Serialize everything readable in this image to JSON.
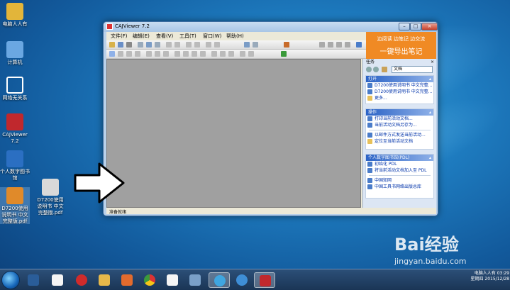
{
  "desktop": {
    "icons": [
      {
        "label": "电脑人人有",
        "color": "#e2b53a"
      },
      {
        "label": "计算机",
        "color": "#6aa7e2"
      },
      {
        "label": "网络无关系",
        "color": "#ffffff"
      },
      {
        "label": "CAJViewer 7.2",
        "color": "#c0282d"
      },
      {
        "label": "个人数字图书馆",
        "color": "#2b6fc2"
      },
      {
        "label": "D7200使用说明书 中文完整版.pdf",
        "color": "#e08a2a"
      },
      {
        "label": "D7200使用说明书 中文完整版.pdf",
        "color": "#d9d9d9"
      }
    ]
  },
  "window": {
    "title": "CAJViewer 7.2",
    "controls": {
      "minimize": "–",
      "maximize": "□",
      "close": "×"
    },
    "menu": [
      "文件(F)",
      "编辑(E)",
      "查看(V)",
      "工具(T)",
      "窗口(W)",
      "帮助(H)"
    ],
    "promo": {
      "line1": "边阅读 边笔记 边交流",
      "line2": "一键导出笔记"
    },
    "status": "准备就绪"
  },
  "task_pane": {
    "title": "任务",
    "close": "×",
    "selector": "文档",
    "sections": [
      {
        "title": "打开",
        "items": [
          {
            "text": "D7200使用说明书 中文完整...",
            "icon": "document-icon"
          },
          {
            "text": "D7200使用说明书 中文完整...",
            "icon": "document-icon"
          },
          {
            "text": "更多...",
            "icon": "folder-icon"
          }
        ]
      },
      {
        "title": "操作",
        "items": [
          {
            "text": "打印当前活动文档...",
            "icon": "print-icon"
          },
          {
            "text": "当前活动文档另存为...",
            "icon": "save-icon"
          },
          {
            "text": "以邮件方式发送当前活动...",
            "icon": "email-icon"
          },
          {
            "text": "定位至当前活动文档",
            "icon": "locate-icon"
          }
        ]
      },
      {
        "title": "个人数字图书馆(PDL)",
        "items": [
          {
            "text": "初始化 PDL",
            "icon": "init-icon"
          },
          {
            "text": "将当前活动文档加入至 PDL",
            "icon": "add-icon"
          },
          {
            "text": "中国知网",
            "icon": "web-icon"
          },
          {
            "text": "中国工具书网络出版总库",
            "icon": "web-icon"
          }
        ]
      }
    ]
  },
  "taskbar": {
    "apps": [
      {
        "name": "desktop-app",
        "color": "#2a5d99"
      },
      {
        "name": "explorer-app",
        "color": "#f5f5f5"
      },
      {
        "name": "chinese-app",
        "color": "#d02b2b"
      },
      {
        "name": "folder-app",
        "color": "#e6b84a"
      },
      {
        "name": "photo-app",
        "color": "#e36b2d"
      },
      {
        "name": "chrome-app",
        "color": "#3b9b3b"
      },
      {
        "name": "document-app",
        "color": "#f5f5f5"
      },
      {
        "name": "pinyin-app",
        "color": "#3fa6e0"
      },
      {
        "name": "ie-app",
        "color": "#3e8ed6"
      },
      {
        "name": "cajviewer-app",
        "color": "#c0282d"
      }
    ],
    "tray": {
      "user": "电脑人人有",
      "time": "03:29",
      "date": "星期四 2015/12/28"
    }
  },
  "watermark": {
    "brand": "Bai经验",
    "url": "jingyan.baidu.com"
  }
}
